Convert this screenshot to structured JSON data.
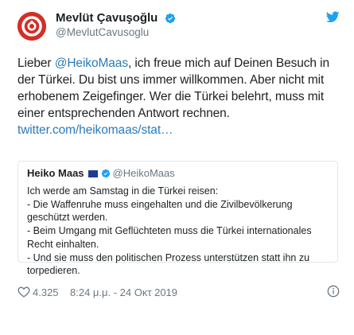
{
  "author": {
    "display_name": "Mevlüt Çavuşoğlu",
    "handle": "@MevlutCavusoglu"
  },
  "tweet": {
    "text_before": "Lieber ",
    "mention": "@HeikoMaas",
    "text_after": ", ich freue mich auf Deinen Besuch in der Türkei. Du bist uns immer willkommen. Aber nicht mit erhobenem Zeigefinger. Wer die Türkei belehrt, muss mit einer entsprechenden Antwort rechnen. ",
    "link": "twitter.com/heikomaas/stat…"
  },
  "quoted_tweet": {
    "display_name": "Heiko Maas",
    "handle": "@HeikoMaas",
    "lines": [
      "Ich werde am Samstag in die Türkei reisen:",
      "- Die Waffenruhe muss eingehalten und die Zivilbevölkerung geschützt werden.",
      "- Beim Umgang mit Geflüchteten muss die Türkei internationales Recht einhalten.",
      "- Und sie muss den politischen Prozess unterstützen statt ihn zu torpedieren."
    ]
  },
  "footer": {
    "likes": "4.325",
    "timestamp": "8:24 μ.μ. - 24 Οκτ 2019"
  },
  "icons": {
    "avatar": "avatar-logo",
    "verified": "verified-badge-icon",
    "twitter": "twitter-bird-icon",
    "heart": "heart-icon",
    "info": "info-icon",
    "flag": "eu-flag-icon"
  },
  "colors": {
    "link": "#2b7bb9",
    "verified": "#1da1f2",
    "muted": "#697882",
    "avatar_red": "#d42e26"
  }
}
